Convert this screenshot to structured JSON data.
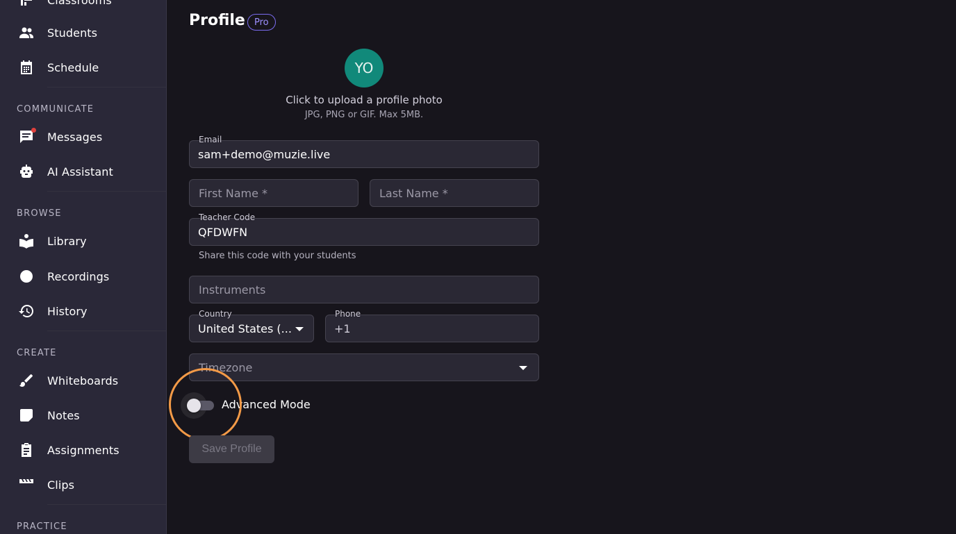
{
  "sidebar": {
    "top_item_partial": "Classrooms",
    "items": [
      {
        "label": "Students",
        "icon": "students-icon"
      },
      {
        "label": "Schedule",
        "icon": "calendar-icon"
      },
      {
        "label": "Messages",
        "icon": "messages-icon"
      },
      {
        "label": "AI Assistant",
        "icon": "robot-icon"
      },
      {
        "label": "Library",
        "icon": "library-icon"
      },
      {
        "label": "Recordings",
        "icon": "record-icon"
      },
      {
        "label": "History",
        "icon": "history-icon"
      },
      {
        "label": "Whiteboards",
        "icon": "brush-icon"
      },
      {
        "label": "Notes",
        "icon": "note-icon"
      },
      {
        "label": "Assignments",
        "icon": "clipboard-icon"
      },
      {
        "label": "Clips",
        "icon": "clapperboard-icon"
      }
    ],
    "sections": {
      "communicate": "COMMUNICATE",
      "browse": "BROWSE",
      "create": "CREATE",
      "practice": "PRACTICE"
    }
  },
  "profile": {
    "title": "Profile",
    "badge": "Pro",
    "avatar_initials": "YO",
    "upload_text": "Click to upload a profile photo",
    "upload_hint": "JPG, PNG or GIF. Max 5MB.",
    "email": {
      "label": "Email",
      "value": "sam+demo@muzie.live"
    },
    "first_name": {
      "placeholder": "First Name *"
    },
    "last_name": {
      "placeholder": "Last Name *"
    },
    "teacher_code": {
      "label": "Teacher Code",
      "value": "QFDWFN",
      "helper": "Share this code with your students"
    },
    "instruments": {
      "placeholder": "Instruments"
    },
    "country": {
      "label": "Country",
      "value": "United States (..."
    },
    "phone": {
      "label": "Phone",
      "value": "+1"
    },
    "timezone": {
      "placeholder": "Timezone"
    },
    "advanced_mode": {
      "label": "Advanced Mode",
      "enabled": false
    },
    "save_label": "Save Profile"
  },
  "colors": {
    "background": "#17151c",
    "sidebar": "#2a2838",
    "accent": "#7b6cf0",
    "avatar": "#11897a",
    "highlight": "#f39a47"
  }
}
